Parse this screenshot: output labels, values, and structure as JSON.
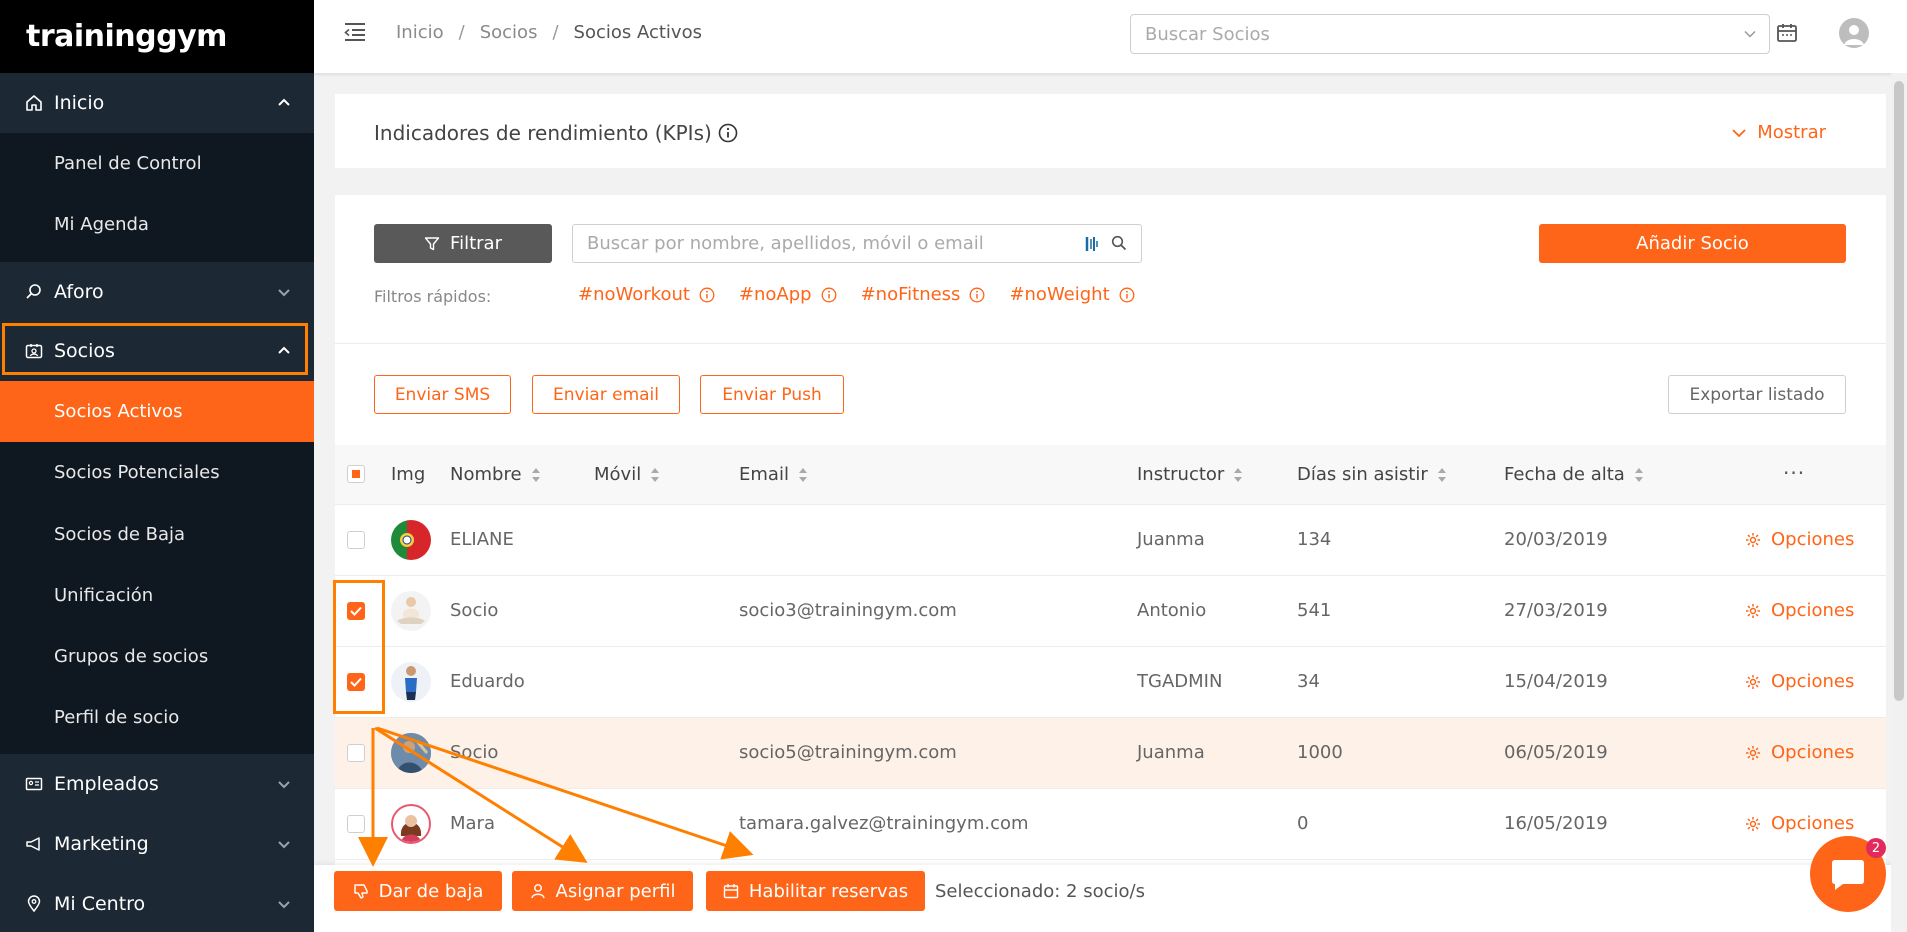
{
  "app": {
    "logo": "traininggym"
  },
  "sidebar": {
    "sections": [
      {
        "label": "Inicio"
      },
      {
        "label": "Aforo"
      },
      {
        "label": "Socios"
      },
      {
        "label": "Empleados"
      },
      {
        "label": "Marketing"
      },
      {
        "label": "Mi Centro"
      }
    ],
    "inicio_items": [
      "Panel de Control",
      "Mi Agenda"
    ],
    "socios_items": [
      "Socios Activos",
      "Socios Potenciales",
      "Socios de Baja",
      "Unificación",
      "Grupos de socios",
      "Perfil de socio"
    ]
  },
  "topbar": {
    "breadcrumb": [
      "Inicio",
      "Socios",
      "Socios Activos"
    ],
    "search_placeholder": "Buscar Socios"
  },
  "kpi": {
    "title": "Indicadores de rendimiento (KPIs)",
    "toggle": "Mostrar"
  },
  "toolbar": {
    "filter_label": "Filtrar",
    "search_placeholder": "Buscar por nombre, apellidos, móvil o email",
    "add_label": "Añadir Socio",
    "quick_filters_label": "Filtros rápidos:",
    "quick_filters": [
      "#noWorkout",
      "#noApp",
      "#noFitness",
      "#noWeight"
    ],
    "send_sms": "Enviar SMS",
    "send_email": "Enviar email",
    "send_push": "Enviar Push",
    "export": "Exportar listado"
  },
  "table": {
    "columns": [
      "Img",
      "Nombre",
      "Móvil",
      "Email",
      "Instructor",
      "Días sin asistir",
      "Fecha de alta"
    ],
    "more": "...",
    "rows": [
      {
        "nombre": "ELIANE",
        "movil": "",
        "email": "",
        "instructor": "Juanma",
        "dias": "134",
        "fecha": "20/03/2019",
        "checked": false,
        "avatar": "flag"
      },
      {
        "nombre": "Socio",
        "movil": "",
        "email": "socio3@trainingym.com",
        "instructor": "Antonio",
        "dias": "541",
        "fecha": "27/03/2019",
        "checked": true,
        "avatar": "yoga"
      },
      {
        "nombre": "Eduardo",
        "movil": "",
        "email": "",
        "instructor": "TGADMIN",
        "dias": "34",
        "fecha": "15/04/2019",
        "checked": true,
        "avatar": "athlete"
      },
      {
        "nombre": "Socio",
        "movil": "",
        "email": "socio5@trainingym.com",
        "instructor": "Juanma",
        "dias": "1000",
        "fecha": "06/05/2019",
        "checked": false,
        "avatar": "photo"
      },
      {
        "nombre": "Mara",
        "movil": "",
        "email": "tamara.galvez@trainingym.com",
        "instructor": "",
        "dias": "0",
        "fecha": "16/05/2019",
        "checked": false,
        "avatar": "woman"
      }
    ],
    "options_label": "Opciones"
  },
  "bulk": {
    "dar_baja": "Dar de baja",
    "asignar_perfil": "Asignar perfil",
    "habilitar_reservas": "Habilitar reservas",
    "selected": "Seleccionado: 2 socio/s"
  },
  "chat": {
    "badge": "2"
  },
  "colors": {
    "accent": "#ff6518",
    "sidebar": "#0f1821",
    "highlight": "#ff8000"
  }
}
